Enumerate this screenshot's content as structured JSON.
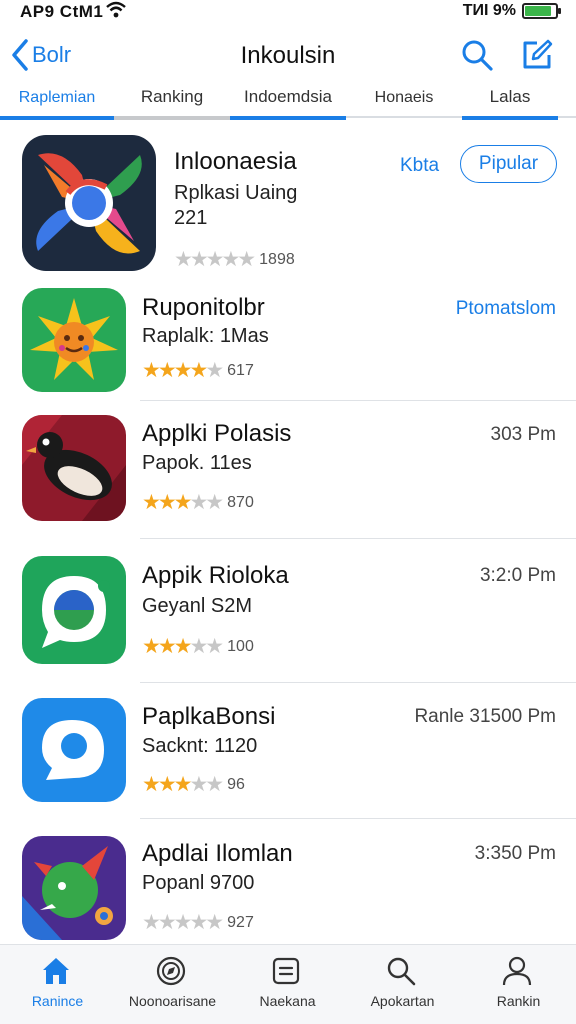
{
  "status": {
    "carrier": "AP9 CtM1",
    "right": "TИI 9%"
  },
  "nav": {
    "back_label": "Bolr",
    "title": "Inkoulsin"
  },
  "tabs": [
    {
      "label": "Raplemian",
      "active": true
    },
    {
      "label": "Ranking",
      "active": false
    },
    {
      "label": "Indoemdsia",
      "active": false
    },
    {
      "label": "Honaeis",
      "active": false
    },
    {
      "label": "Lalas",
      "active": false
    }
  ],
  "apps": [
    {
      "title": "Inloonaesia",
      "sub": "Rplkasi Uaing",
      "sub2": "221",
      "rating": 0,
      "count": "1898",
      "meta": "Kbta",
      "action": "Pipular",
      "icon": "chrome-like-icon"
    },
    {
      "title": "Ruponitolbr",
      "sub": "Raplalk: 1Mas",
      "rating": 4,
      "count": "617",
      "meta": "Ptomatslom",
      "icon": "sunflower-icon"
    },
    {
      "title": "Applki Polasis",
      "sub": "Papok. 11es",
      "rating": 3,
      "count": "870",
      "meta": "303 Pm",
      "icon": "penguin-icon"
    },
    {
      "title": "Appik Rioloka",
      "sub": "Geyanl  S2M",
      "rating": 3,
      "count": "100",
      "meta": "3:2:0 Pm",
      "icon": "chat-bubble-icon"
    },
    {
      "title": "PaplkaBonsi",
      "sub": "Sacknt:  1120",
      "rating": 3,
      "count": "96",
      "meta": "Ranle 31500 Pm",
      "icon": "message-icon"
    },
    {
      "title": "Apdlai Ilomlan",
      "sub": "Popanl  9700",
      "rating": 0,
      "count": "927",
      "meta": "3:350 Pm",
      "icon": "dragon-icon"
    }
  ],
  "bottom_tabs": [
    {
      "label": "Ranince",
      "icon": "home-icon",
      "active": true
    },
    {
      "label": "Noonoarisane",
      "icon": "compass-icon",
      "active": false
    },
    {
      "label": "Naekana",
      "icon": "list-icon",
      "active": false
    },
    {
      "label": "Apokartan",
      "icon": "search-icon",
      "active": false
    },
    {
      "label": "Rankin",
      "icon": "person-icon",
      "active": false
    }
  ],
  "colors": {
    "accent": "#1a7ee6",
    "star": "#f4a51c"
  }
}
